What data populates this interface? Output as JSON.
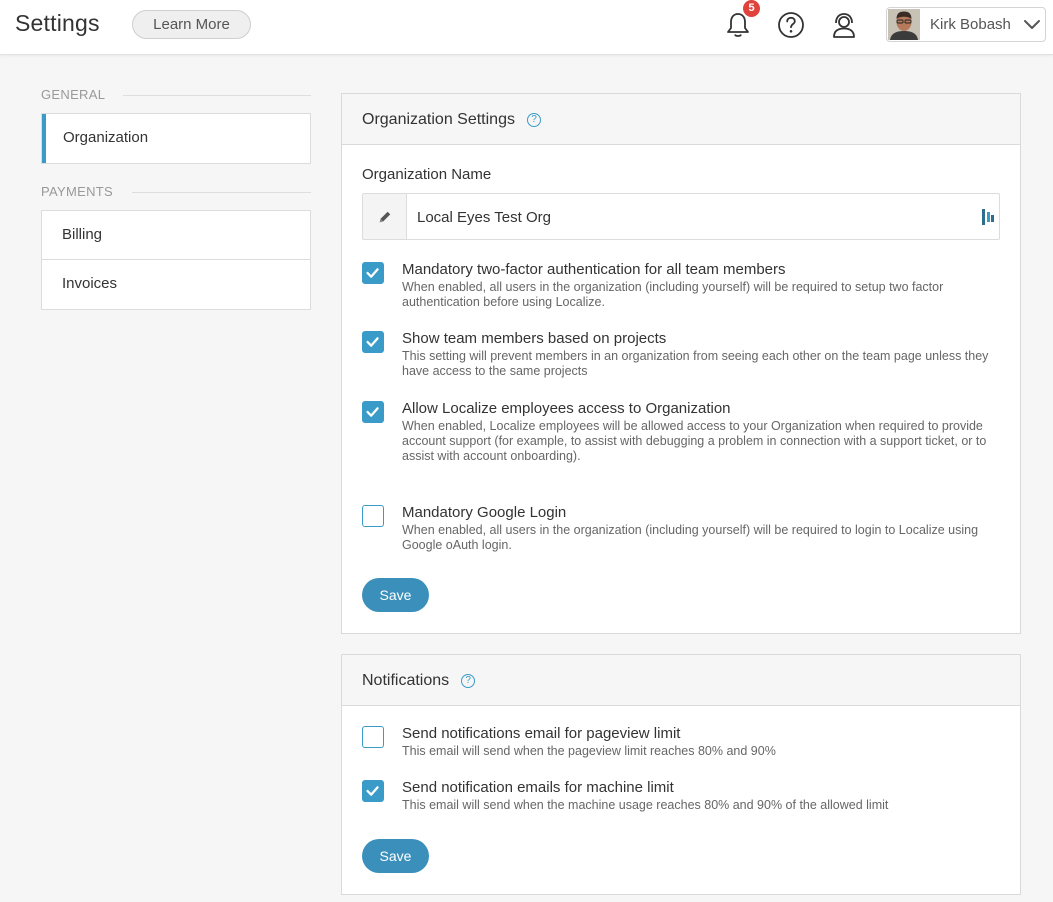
{
  "header": {
    "title": "Settings",
    "learn_more": "Learn More",
    "notification_count": "5",
    "user_name": "Kirk Bobash"
  },
  "sidebar": {
    "sections": [
      {
        "label": "GENERAL",
        "items": [
          {
            "label": "Organization",
            "active": true
          }
        ]
      },
      {
        "label": "PAYMENTS",
        "items": [
          {
            "label": "Billing"
          },
          {
            "label": "Invoices"
          }
        ]
      }
    ]
  },
  "org_settings": {
    "title": "Organization Settings",
    "name_label": "Organization Name",
    "name_value": "Local Eyes Test Org",
    "options": [
      {
        "title": "Mandatory two-factor authentication for all team members",
        "description": "When enabled, all users in the organization (including yourself) will be required to setup two factor authentication before using Localize.",
        "checked": true
      },
      {
        "title": "Show team members based on projects",
        "description": "This setting will prevent members in an organization from seeing each other on the team page unless they have access to the same projects",
        "checked": true
      },
      {
        "title": "Allow Localize employees access to Organization",
        "description": "When enabled, Localize employees will be allowed access to your Organization when required to provide account support (for example, to assist with debugging a problem in connection with a support ticket, or to assist with account onboarding).",
        "checked": true
      },
      {
        "title": "Mandatory Google Login",
        "description": "When enabled, all users in the organization (including yourself) will be required to login to Localize using Google oAuth login.",
        "checked": false
      }
    ],
    "save_label": "Save"
  },
  "notifications": {
    "title": "Notifications",
    "options": [
      {
        "title": "Send notifications email for pageview limit",
        "description": "This email will send when the pageview limit reaches 80% and 90%",
        "checked": false
      },
      {
        "title": "Send notification emails for machine limit",
        "description": "This email will send when the machine usage reaches 80% and 90% of the allowed limit",
        "checked": true
      }
    ],
    "save_label": "Save"
  },
  "colors": {
    "accent": "#3a9bc9",
    "button": "#3a8fbb",
    "badge": "#e0433b",
    "background": "#f6f6f6"
  },
  "icons": {
    "bell": "bell-icon",
    "help": "help-circle-icon",
    "support": "support-headset-icon",
    "pencil": "pencil-icon",
    "caret": "chevron-down-icon",
    "question": "question-circle-icon",
    "check": "check-icon"
  }
}
